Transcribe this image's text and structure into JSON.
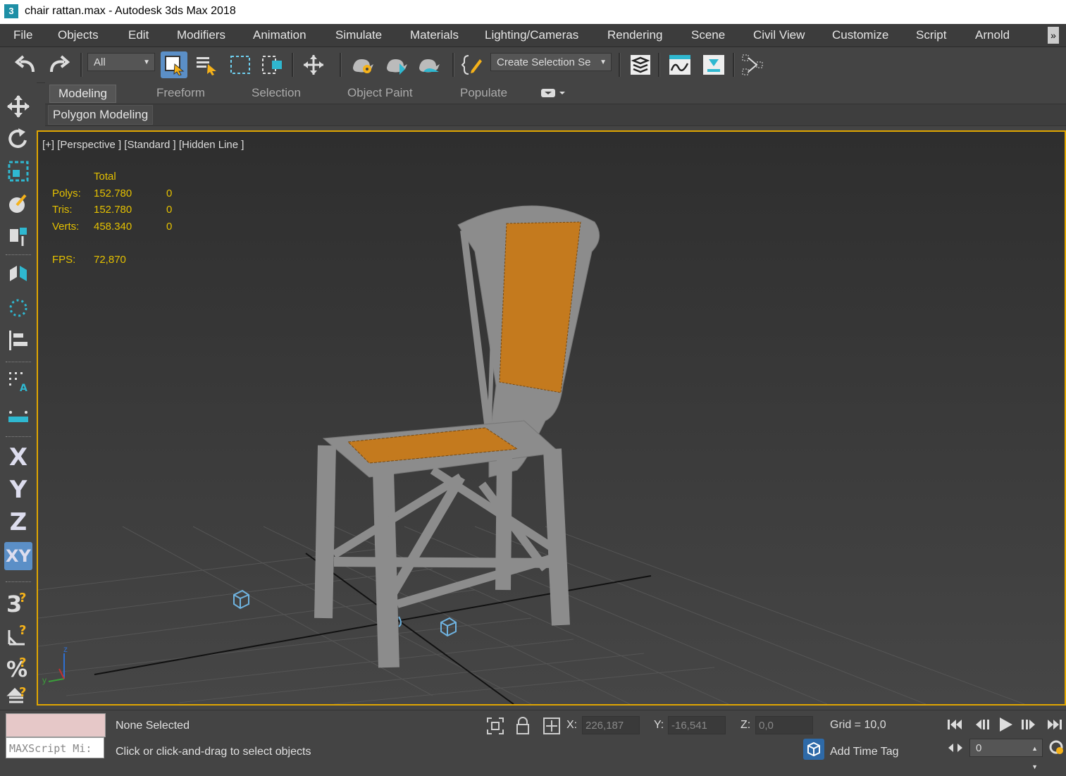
{
  "window": {
    "title": "chair rattan.max - Autodesk 3ds Max 2018",
    "app_icon": "3"
  },
  "menu": [
    "File",
    "Objects",
    "Edit",
    "Modifiers",
    "Animation",
    "Simulate",
    "Materials",
    "Lighting/Cameras",
    "Rendering",
    "Scene",
    "Civil View",
    "Customize",
    "Script",
    "Arnold"
  ],
  "menu_overflow": "»",
  "toolbar": {
    "filter_value": "All",
    "selection_set_value": "Create Selection Se"
  },
  "ribbon": {
    "tabs": [
      "Modeling",
      "Freeform",
      "Selection",
      "Object Paint",
      "Populate"
    ],
    "active_tab": "Modeling",
    "panel_title": "Polygon Modeling"
  },
  "left_toolbar": {
    "axis_x": "X",
    "axis_y": "Y",
    "axis_z": "Z",
    "axis_xy": "XY"
  },
  "viewport": {
    "label": "[+] [Perspective ] [Standard ] [Hidden Line ]",
    "stats": {
      "header": "Total",
      "polys_label": "Polys:",
      "polys_total": "152.780",
      "polys_sel": "0",
      "tris_label": "Tris:",
      "tris_total": "152.780",
      "tris_sel": "0",
      "verts_label": "Verts:",
      "verts_total": "458.340",
      "verts_sel": "0",
      "fps_label": "FPS:",
      "fps_value": "72,870"
    },
    "gizmo": {
      "z": "z",
      "y": "y"
    }
  },
  "status": {
    "selection": "None Selected",
    "prompt": "Click or click-and-drag to select objects",
    "maxscript_placeholder": "MAXScript Mi:",
    "x_label": "X:",
    "x_value": "226,187",
    "y_label": "Y:",
    "y_value": "-16,541",
    "z_label": "Z:",
    "z_value": "0,0",
    "grid": "Grid = 10,0",
    "add_time_tag": "Add Time Tag",
    "frame_value": "0"
  },
  "colors": {
    "accent_blue": "#5b8fc7",
    "viewport_border": "#e0a600",
    "stats_text": "#e4c000",
    "wireframe": "#8c8c8c",
    "rattan": "#c47a1e"
  }
}
